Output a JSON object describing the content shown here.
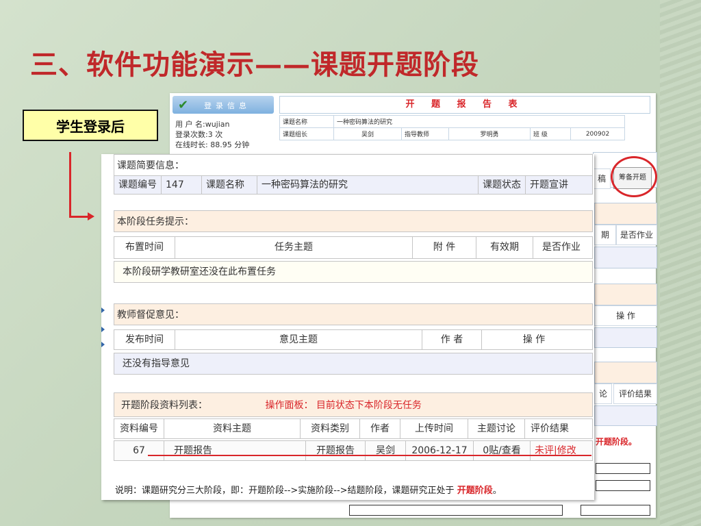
{
  "slide_title": "三、软件功能演示——课题开题阶段",
  "callout_label": "学生登录后",
  "login_panel": {
    "header": "登录信息",
    "user": "用 户 名:wujian",
    "count": "登录次数:3 次",
    "online": "在线时长: 88.95 分钟"
  },
  "report": {
    "title": "开 题 报 告 表",
    "rows": [
      [
        "课题名称",
        "一种密码算法的研究",
        "",
        "",
        "",
        ""
      ],
      [
        "课题组长",
        "吴剑",
        "指导教师",
        "罗明勇",
        "班 级",
        "200902"
      ]
    ]
  },
  "bg_window": {
    "plan_button": "筹备开题",
    "col_tail": "稿",
    "col_date": "期",
    "col_homework": "是否作业",
    "col_op": "操 作",
    "col_disc": "论",
    "col_eval": "评价结果",
    "status_bold": "开题阶段",
    "status_dot": "。"
  },
  "brief": {
    "header": "课题简要信息：",
    "id_label": "课题编号",
    "id_value": "147",
    "name_label": "课题名称",
    "name_value": "一种密码算法的研究",
    "status_label": "课题状态",
    "status_value": "开题宣讲"
  },
  "task": {
    "header": "本阶段任务提示：",
    "columns": [
      "布置时间",
      "任务主题",
      "附 件",
      "有效期",
      "是否作业"
    ],
    "empty": "本阶段研学教研室还没在此布置任务"
  },
  "opinion": {
    "header": "教师督促意见：",
    "columns": [
      "发布时间",
      "意见主题",
      "作 者",
      "操 作"
    ],
    "empty": "还没有指导意见"
  },
  "materials": {
    "header": "开题阶段资料列表：",
    "panel": "操作面板：  目前状态下本阶段无任务",
    "columns": [
      "资料编号",
      "资料主题",
      "资料类别",
      "作者",
      "上传时间",
      "主题讨论",
      "评价结果"
    ],
    "row": [
      "67",
      "开题报告",
      "开题报告",
      "吴剑",
      "2006-12-17",
      "0贴/查看",
      "未评|修改"
    ]
  },
  "note": {
    "text": "说明：课题研究分三大阶段，即：开题阶段-->实施阶段-->结题阶段，课题研究正处于 ",
    "highlight": "开题阶段",
    "end": "。"
  }
}
